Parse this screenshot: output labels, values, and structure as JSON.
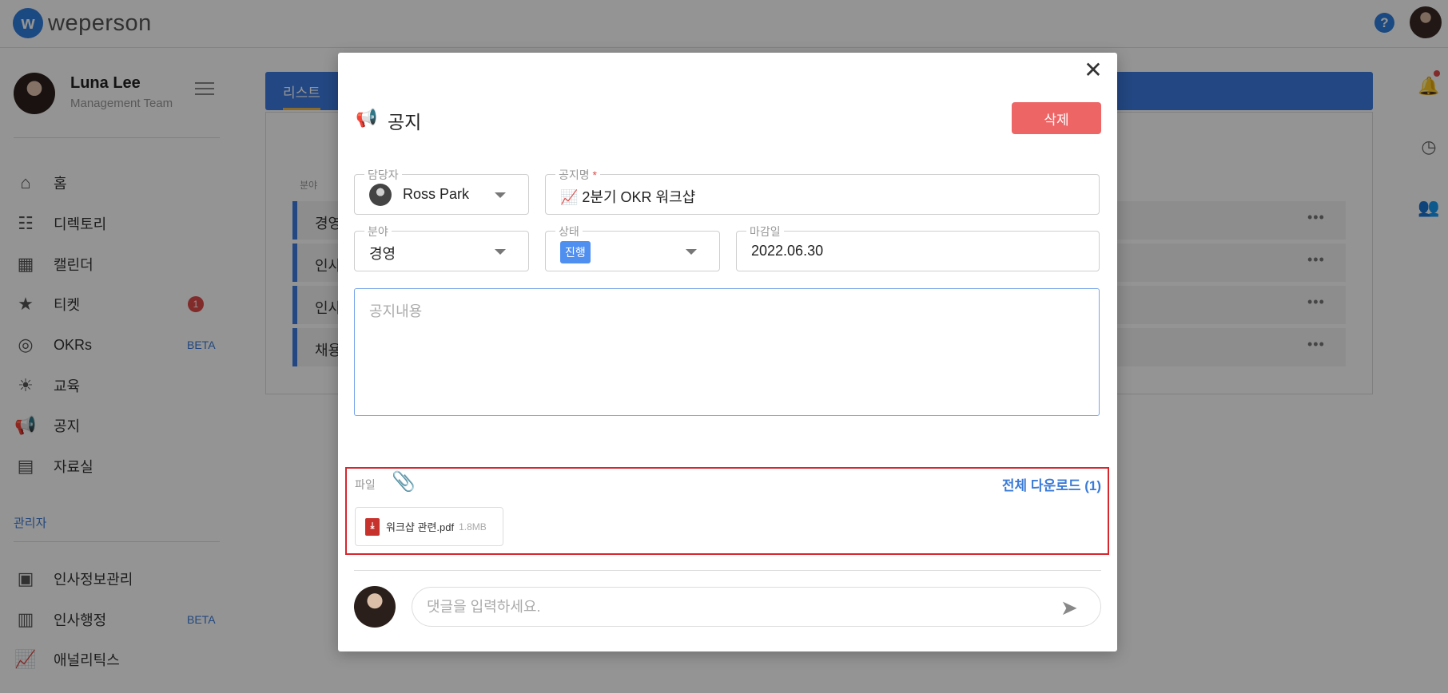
{
  "app": {
    "logo_text": "weperson",
    "logo_mark": "w",
    "help_icon": "?"
  },
  "sidebar": {
    "profile": {
      "name": "Luna Lee",
      "team": "Management Team"
    },
    "items": [
      {
        "label": "홈",
        "icon": "home-icon"
      },
      {
        "label": "디렉토리",
        "icon": "org-chart-icon"
      },
      {
        "label": "캘린더",
        "icon": "calendar-icon"
      },
      {
        "label": "티켓",
        "icon": "ticket-icon",
        "badge": "1"
      },
      {
        "label": "OKRs",
        "icon": "target-icon",
        "tag": "BETA"
      },
      {
        "label": "교육",
        "icon": "lightbulb-icon"
      },
      {
        "label": "공지",
        "icon": "megaphone-icon"
      },
      {
        "label": "자료실",
        "icon": "cabinet-icon"
      }
    ],
    "admin_title": "관리자",
    "admin_items": [
      {
        "label": "인사정보관리",
        "icon": "id-card-icon"
      },
      {
        "label": "인사행정",
        "icon": "document-icon",
        "tag": "BETA"
      },
      {
        "label": "애널리틱스",
        "icon": "chart-line-icon"
      }
    ]
  },
  "main": {
    "tab_label": "리스트",
    "column_header": "분야",
    "rows": [
      "경영",
      "인사",
      "인사",
      "채용"
    ]
  },
  "modal": {
    "title": "공지",
    "delete_label": "삭제",
    "fields": {
      "assignee": {
        "label": "담당자",
        "value": "Ross Park"
      },
      "notice_name": {
        "label": "공지명",
        "required_mark": "*",
        "value": "📈 2분기 OKR 워크샵"
      },
      "category": {
        "label": "분야",
        "value": "경영"
      },
      "status": {
        "label": "상태",
        "value": "진행"
      },
      "deadline": {
        "label": "마감일",
        "value": "2022.06.30"
      }
    },
    "content": {
      "placeholder": "공지내용",
      "value": ""
    },
    "files": {
      "label": "파일",
      "download_all": "전체 다운로드 (1)",
      "items": [
        {
          "name": "워크샵 관련.pdf",
          "size": "1.8MB"
        }
      ]
    },
    "comment": {
      "placeholder": "댓글을 입력하세요.",
      "value": ""
    }
  },
  "colors": {
    "brand": "#3d7be0",
    "delete": "#ee6566",
    "status_chip": "#4f8ff0",
    "highlight_border": "#d8262d"
  }
}
